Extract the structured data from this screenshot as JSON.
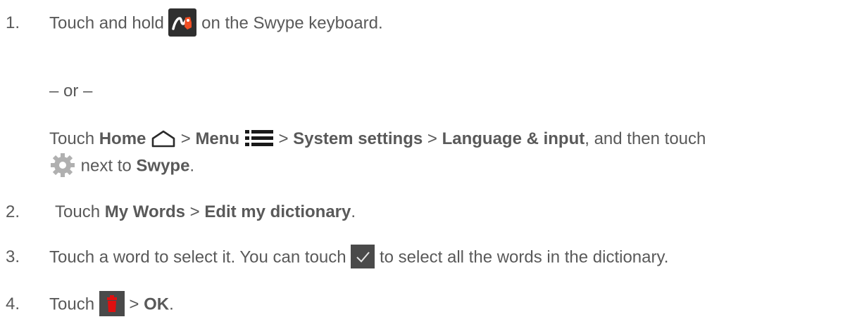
{
  "steps": [
    {
      "number": "1.",
      "text_a": "Touch and hold",
      "text_b": "on the Swype keyboard.",
      "or": "– or –",
      "alt_touch": "Touch",
      "home": "Home",
      "sep1": ">",
      "menu": "Menu",
      "sep2": ">",
      "system_settings": "System settings",
      "sep3": ">",
      "language_input": "Language & input",
      "then_touch": ", and then touch",
      "next_to": "next to",
      "swype": "Swype",
      "period": "."
    },
    {
      "number": "2.",
      "touch": "Touch",
      "my_words": "My Words",
      "sep": ">",
      "edit_dictionary": "Edit my dictionary",
      "period": "."
    },
    {
      "number": "3.",
      "text_a": "Touch a word to select it. You can touch",
      "text_b": "to select all the words in the dictionary."
    },
    {
      "number": "4.",
      "touch": "Touch",
      "sep": ">",
      "ok": "OK",
      "period": "."
    }
  ],
  "icons": {
    "swype_key": "swype-key-icon",
    "home": "home-icon",
    "menu": "menu-icon",
    "settings": "gear-icon",
    "select_all": "checkmark-icon",
    "delete": "trash-icon"
  },
  "colors": {
    "text": "#595959",
    "icon_dark": "#2f2f2f",
    "icon_gray": "#4a4a4a",
    "delete_red": "#e01010",
    "swype_orange": "#f04e23"
  }
}
